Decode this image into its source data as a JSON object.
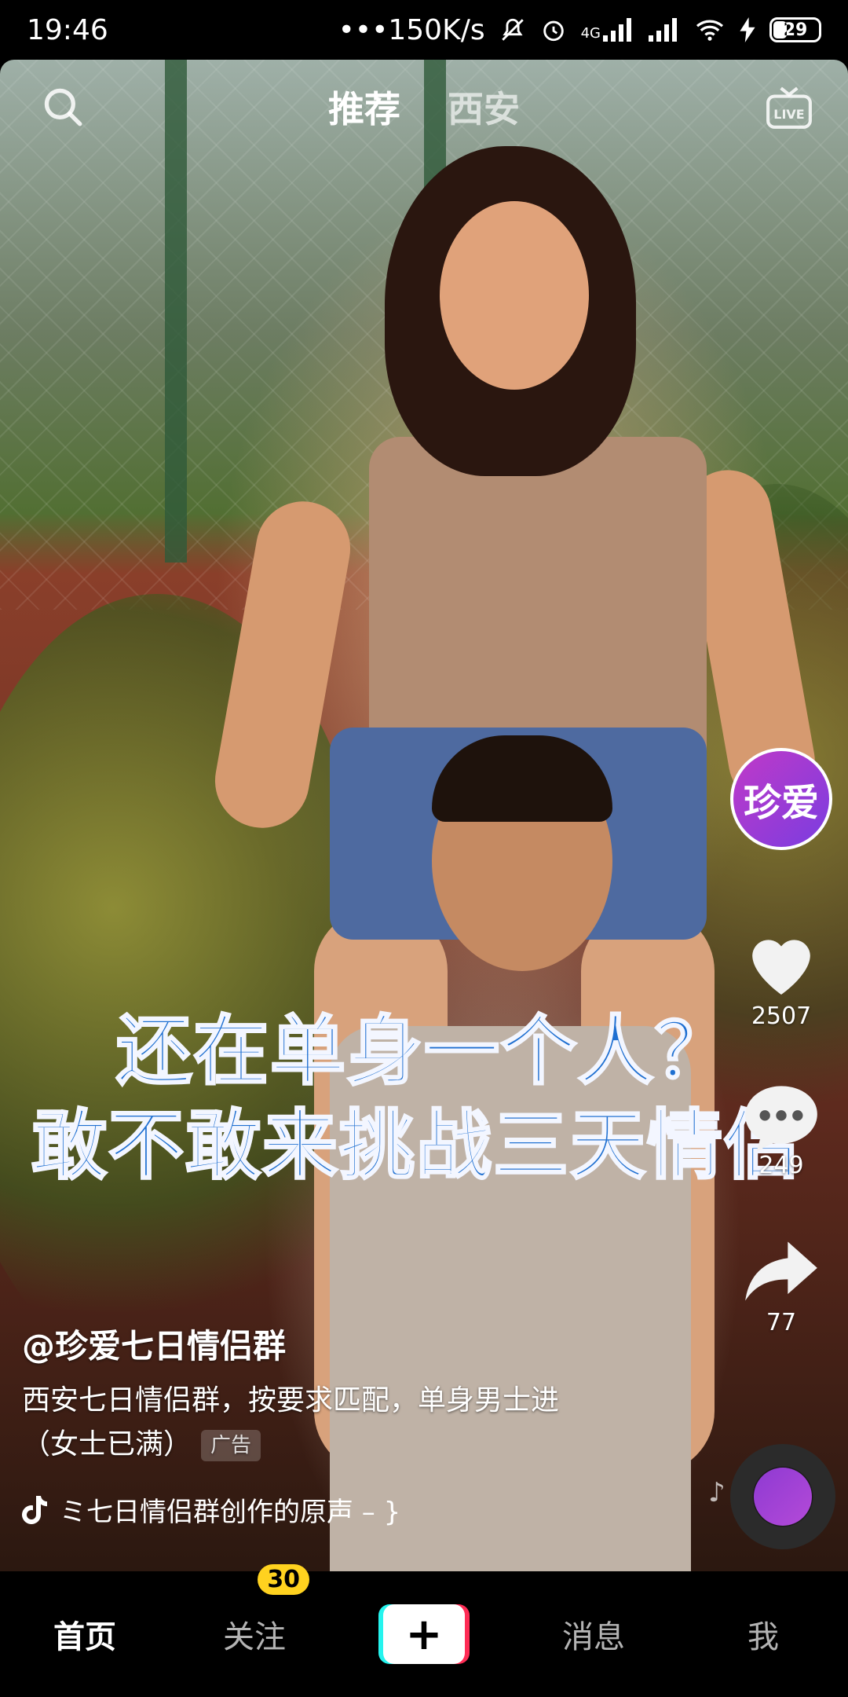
{
  "status_bar": {
    "time": "19:46",
    "network_speed": "•••150K/s",
    "signal_label": "4G",
    "battery": "29"
  },
  "top_nav": {
    "tabs": [
      {
        "label": "推荐",
        "active": true
      },
      {
        "label": "西安",
        "active": false
      }
    ],
    "search_icon": "search-icon",
    "live_icon": "live-icon",
    "live_text": "LIVE"
  },
  "video": {
    "caption_line1": "还在单身一个人？",
    "caption_line2": "敢不敢来挑战三天情侣"
  },
  "right_rail": {
    "avatar_text": "珍爱",
    "like_count": "2507",
    "comment_count": "249",
    "share_count": "77"
  },
  "post": {
    "author": "@珍爱七日情侣群",
    "description_line1": "西安七日情侣群，按要求匹配，单身男士进",
    "description_line2": "（女士已满）",
    "ad_label": "广告",
    "music": "ミ七日情侣群创作的原声 – }"
  },
  "bottom_nav": {
    "items": [
      {
        "label": "首页",
        "active": true
      },
      {
        "label": "关注",
        "badge": "30"
      },
      {
        "label": "+"
      },
      {
        "label": "消息"
      },
      {
        "label": "我"
      }
    ]
  },
  "colors": {
    "caption_blue": "#1e6fd1",
    "badge_yellow": "#ffd21f",
    "plus_cyan": "#25f4ee",
    "plus_red": "#fe2c55",
    "avatar_purple": "#9b3ad8"
  }
}
